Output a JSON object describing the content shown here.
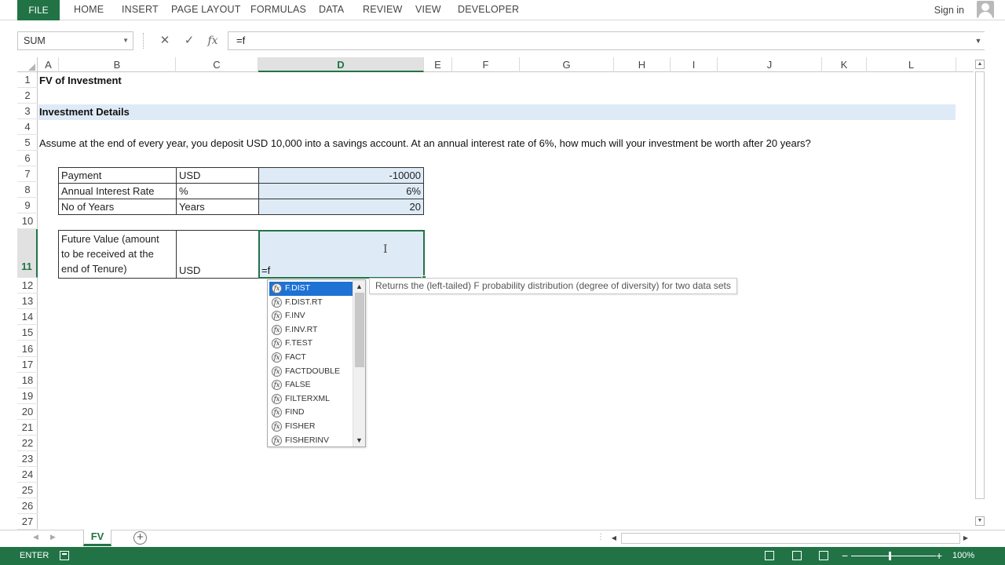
{
  "ribbon": {
    "file": "FILE",
    "tabs": [
      "HOME",
      "INSERT",
      "PAGE LAYOUT",
      "FORMULAS",
      "DATA",
      "REVIEW",
      "VIEW",
      "DEVELOPER"
    ],
    "signin": "Sign in"
  },
  "formula_bar": {
    "name_box": "SUM",
    "formula": "=f"
  },
  "columns": [
    "A",
    "B",
    "C",
    "D",
    "E",
    "F",
    "G",
    "H",
    "I",
    "J",
    "K",
    "L"
  ],
  "active_column": "D",
  "rows": [
    "1",
    "2",
    "3",
    "4",
    "5",
    "6",
    "7",
    "8",
    "9",
    "10",
    "11",
    "12",
    "13",
    "14",
    "15",
    "16",
    "17",
    "18",
    "19",
    "20",
    "21",
    "22",
    "23",
    "24",
    "25",
    "26",
    "27"
  ],
  "active_row": "11",
  "sheet": {
    "title": "FV of Investment",
    "section": "Investment Details",
    "question": "Assume at the end of every year, you deposit USD 10,000 into a savings account. At an annual interest rate of 6%, how much will your investment be worth after 20 years?",
    "inputs": [
      {
        "label": "Payment",
        "unit": "USD",
        "value": "-10000"
      },
      {
        "label": "Annual Interest Rate",
        "unit": "%",
        "value": "6%"
      },
      {
        "label": "No of Years",
        "unit": "Years",
        "value": "20"
      }
    ],
    "result": {
      "label_lines": [
        "Future Value (amount",
        "to be received at the",
        "end of Tenure)"
      ],
      "unit": "USD",
      "editing": "=f"
    }
  },
  "autocomplete": {
    "items": [
      "F.DIST",
      "F.DIST.RT",
      "F.INV",
      "F.INV.RT",
      "F.TEST",
      "FACT",
      "FACTDOUBLE",
      "FALSE",
      "FILTERXML",
      "FIND",
      "FISHER",
      "FISHERINV"
    ],
    "selected": "F.DIST",
    "tooltip": "Returns the (left-tailed) F probability distribution (degree of diversity) for two data sets"
  },
  "sheet_tabs": [
    "FV"
  ],
  "status": {
    "mode": "ENTER",
    "zoom": "100%"
  },
  "colors": {
    "excel_green": "#217346",
    "shade_blue": "#deebf7",
    "select_blue": "#1e72d4"
  }
}
